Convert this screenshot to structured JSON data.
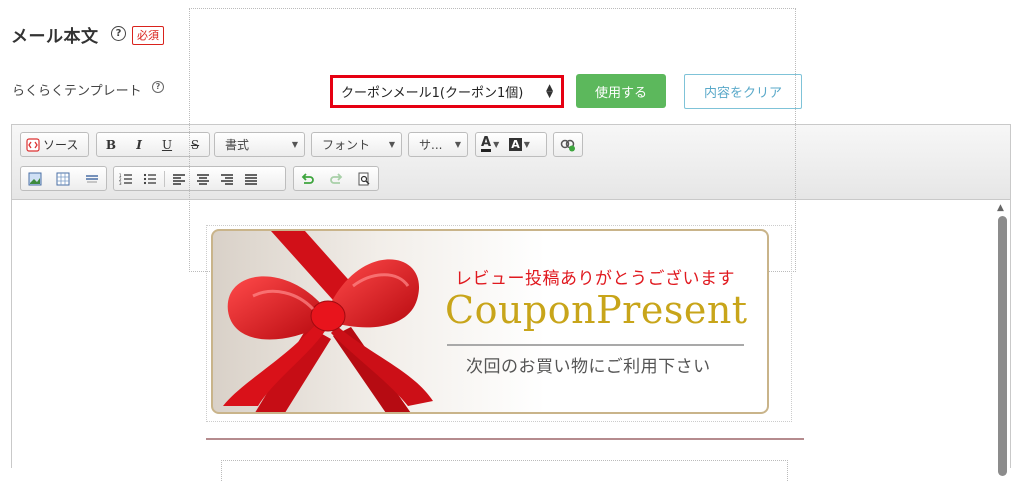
{
  "header": {
    "title": "メール本文",
    "help_glyph": "?",
    "required_badge": "必須"
  },
  "template_row": {
    "label": "らくらくテンプレート",
    "help_glyph": "?",
    "selected": "クーポンメール1(クーポン1個)",
    "use_label": "使用する",
    "clear_label": "内容をクリア"
  },
  "toolbar": {
    "source_label": "ソース",
    "bold": "B",
    "italic": "I",
    "underline": "U",
    "strike": "S",
    "format_label": "書式",
    "font_label": "フォント",
    "size_label": "サ...",
    "text_color_glyph": "A",
    "bg_color_glyph": "A",
    "icons": [
      "source-icon",
      "bold-icon",
      "italic-icon",
      "underline-icon",
      "strike-icon",
      "text-color-icon",
      "bg-color-icon",
      "link-icon",
      "image-icon",
      "table-icon",
      "horizontal-rule-icon",
      "numbered-list-icon",
      "bulleted-list-icon",
      "align-left-icon",
      "align-center-icon",
      "align-right-icon",
      "justify-icon",
      "undo-icon",
      "redo-icon",
      "preview-icon"
    ]
  },
  "banner": {
    "message": "レビュー投稿ありがとうございます",
    "title": "CouponPresent",
    "subtitle": "次回のお買い物にご利用下さい",
    "colors": {
      "message": "#e0191f",
      "title": "#c8a51a",
      "ribbon": "#e8141c",
      "frame": "#c9b48a"
    }
  },
  "colors": {
    "accent_green": "#5cb85c",
    "select_border": "#e60012",
    "clear_border": "#7fc3d8",
    "required": "#d9221c"
  }
}
